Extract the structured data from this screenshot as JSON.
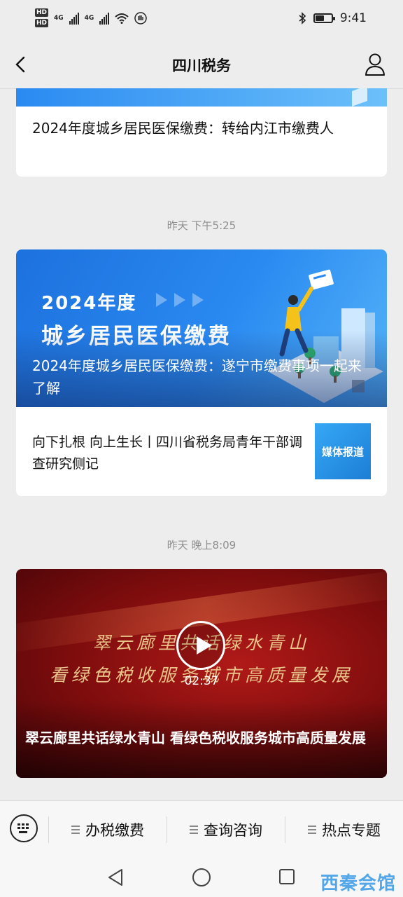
{
  "status_bar": {
    "hd1": "HD",
    "hd2": "HD",
    "net1": "4G",
    "net2": "4G",
    "time": "9:41",
    "battery_level": 0.6
  },
  "header": {
    "title": "四川税务"
  },
  "feed": {
    "items": [
      {
        "title": "2024年度城乡居民医保缴费：转给内江市缴费人"
      },
      {
        "time": "昨天 下午5:25",
        "banner_headline": "2024年度",
        "banner_subheadline": "城乡居民医保缴费",
        "title": "2024年度城乡居民医保缴费：遂宁市缴费事项一起来了解",
        "sub_title": "向下扎根 向上生长丨四川省税务局青年干部调查研究侧记",
        "sub_thumb_text": "媒体报道"
      },
      {
        "time": "昨天 晚上8:09",
        "video_calligraphy_line1": "翠云廊里共话绿水青山",
        "video_calligraphy_line2": "看绿色税收服务城市高质量发展",
        "duration": "02:37",
        "title": "翠云廊里共话绿水青山 看绿色税收服务城市高质量发展"
      }
    ]
  },
  "bottom_menu": {
    "items": [
      {
        "label": "办税缴费"
      },
      {
        "label": "查询咨询"
      },
      {
        "label": "热点专题"
      }
    ]
  },
  "watermark": "西秦会馆",
  "colors": {
    "accent_blue": "#2a8af1",
    "video_red": "#7c0c0d",
    "time_gray": "#8e8e8e"
  }
}
